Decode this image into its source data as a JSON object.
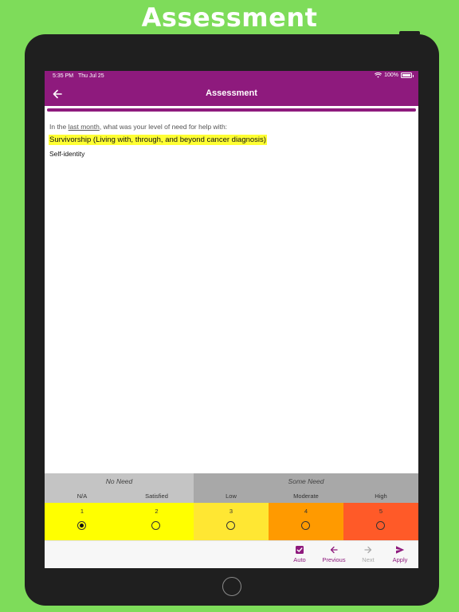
{
  "banner": {
    "title": "Assessment"
  },
  "status_bar": {
    "time": "5:35 PM",
    "date": "Thu Jul 25",
    "battery": "100%"
  },
  "nav": {
    "title": "Assessment"
  },
  "progress": {
    "fraction": 1.0
  },
  "question": {
    "intro_prefix": "In the ",
    "intro_underlined": "last month",
    "intro_suffix": ", what was your level  of need for help with:",
    "domain": "Survivorship (Living with, through, and beyond cancer diagnosis)",
    "item": "Self-identity"
  },
  "scale": {
    "groups": [
      {
        "label": "No Need"
      },
      {
        "label": "Some Need"
      }
    ],
    "options": [
      {
        "label": "N/A",
        "number": "1",
        "color": "#ffff00",
        "selected": true
      },
      {
        "label": "Satisfied",
        "number": "2",
        "color": "#ffff00",
        "selected": false
      },
      {
        "label": "Low",
        "number": "3",
        "color": "#ffe733",
        "selected": false
      },
      {
        "label": "Moderate",
        "number": "4",
        "color": "#ff9a00",
        "selected": false
      },
      {
        "label": "High",
        "number": "5",
        "color": "#ff5a28",
        "selected": false
      }
    ]
  },
  "toolbar": {
    "auto": {
      "label": "Auto",
      "icon": "checkbox-checked-icon"
    },
    "previous": {
      "label": "Previous",
      "icon": "arrow-left-icon"
    },
    "next": {
      "label": "Next",
      "icon": "arrow-right-icon",
      "disabled": true
    },
    "apply": {
      "label": "Apply",
      "icon": "send-icon"
    }
  },
  "colors": {
    "brand": "#8e1a7d",
    "background": "#7edc5a",
    "highlight": "#ffff33"
  }
}
